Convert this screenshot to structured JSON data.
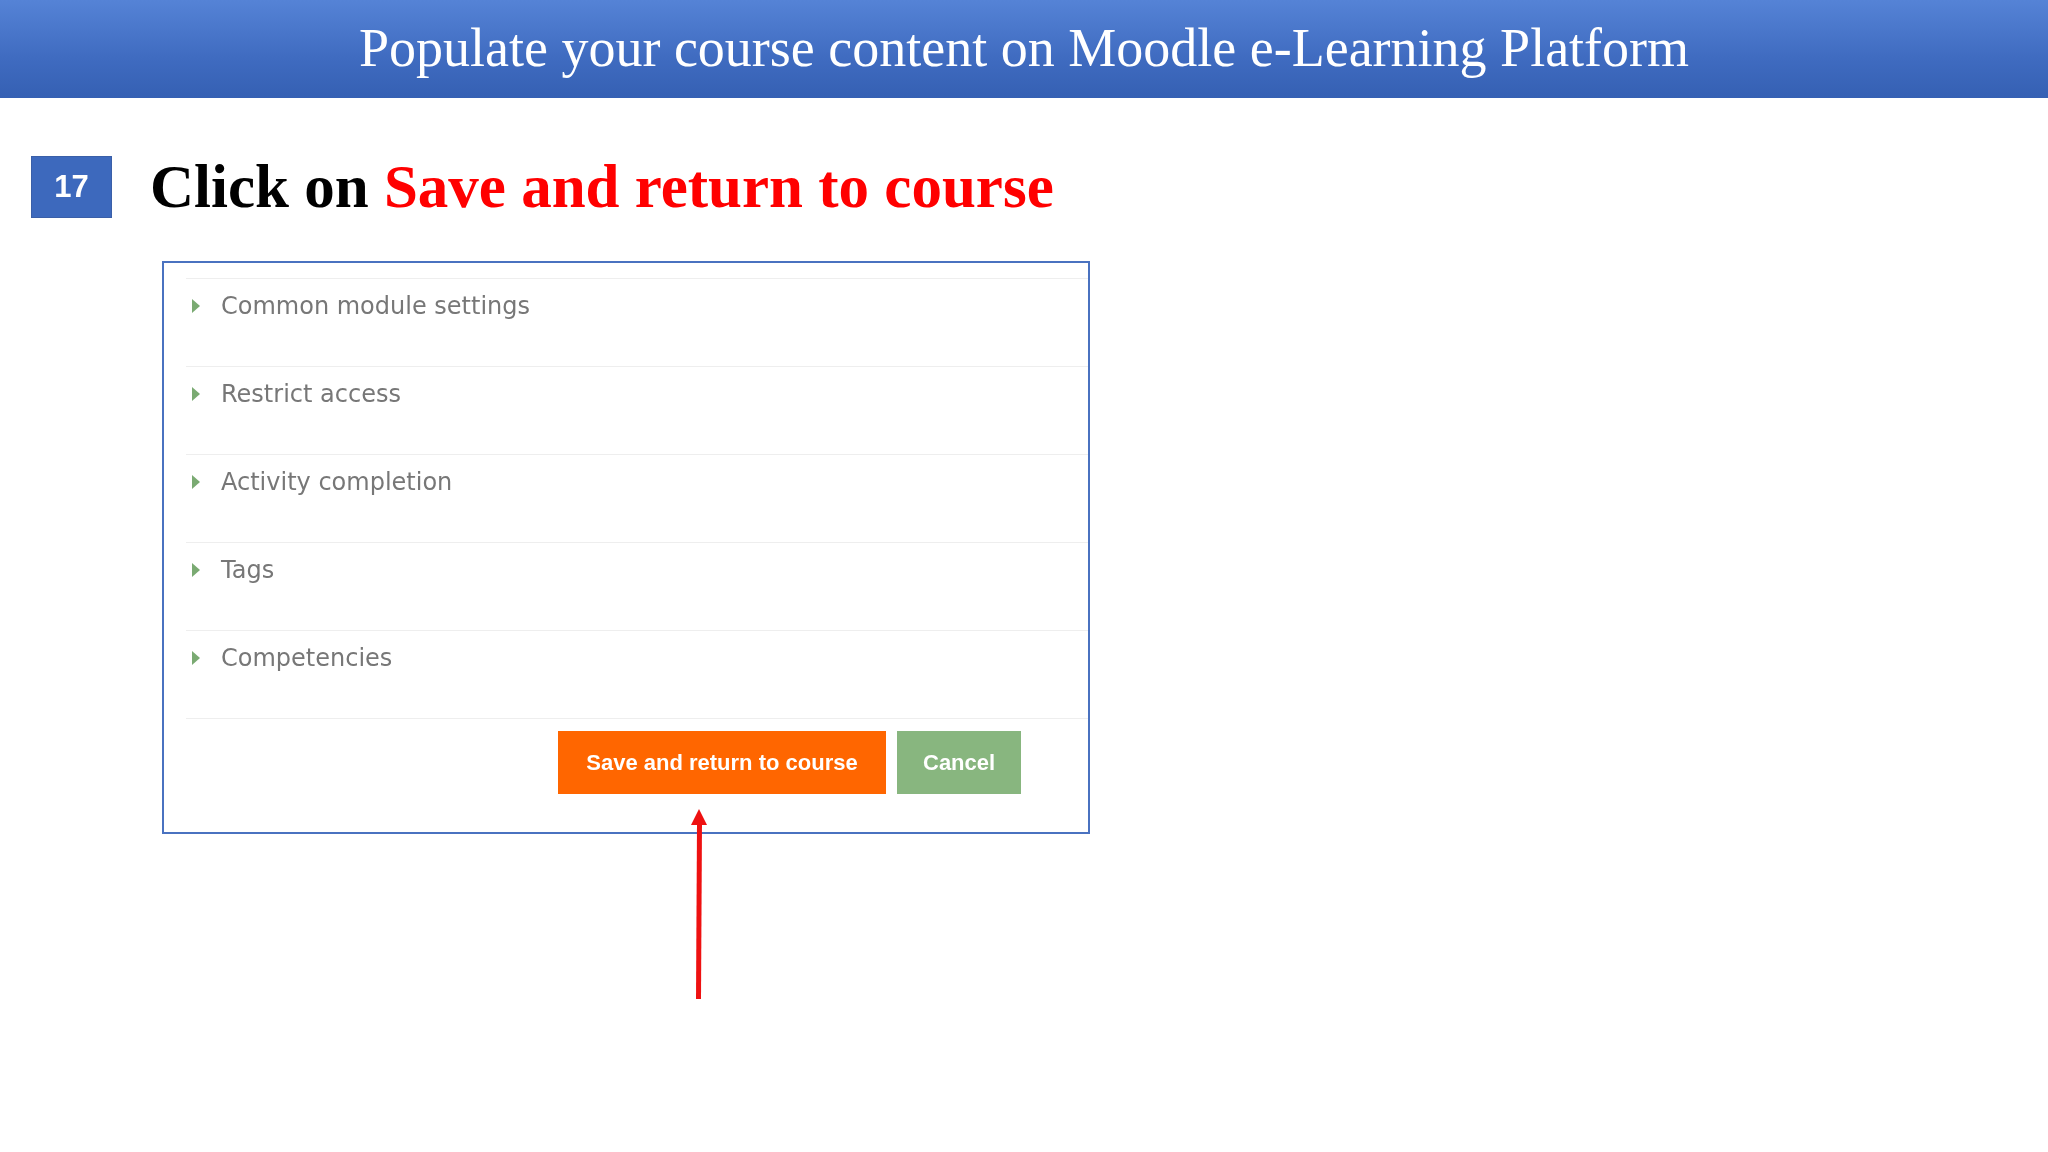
{
  "header": {
    "title": "Populate your course content on Moodle e-Learning Platform"
  },
  "step": {
    "number": "17",
    "lead": "Click on",
    "highlight": "Save and return to course"
  },
  "form": {
    "sections": [
      {
        "label": "Common module settings",
        "expanded": false
      },
      {
        "label": "Restrict access",
        "expanded": false
      },
      {
        "label": "Activity completion",
        "expanded": false
      },
      {
        "label": "Tags",
        "expanded": false
      },
      {
        "label": "Competencies",
        "expanded": false
      }
    ],
    "buttons": [
      {
        "label": "Save and return to course",
        "kind": "primary"
      },
      {
        "label": "Cancel",
        "kind": "secondary"
      }
    ]
  }
}
